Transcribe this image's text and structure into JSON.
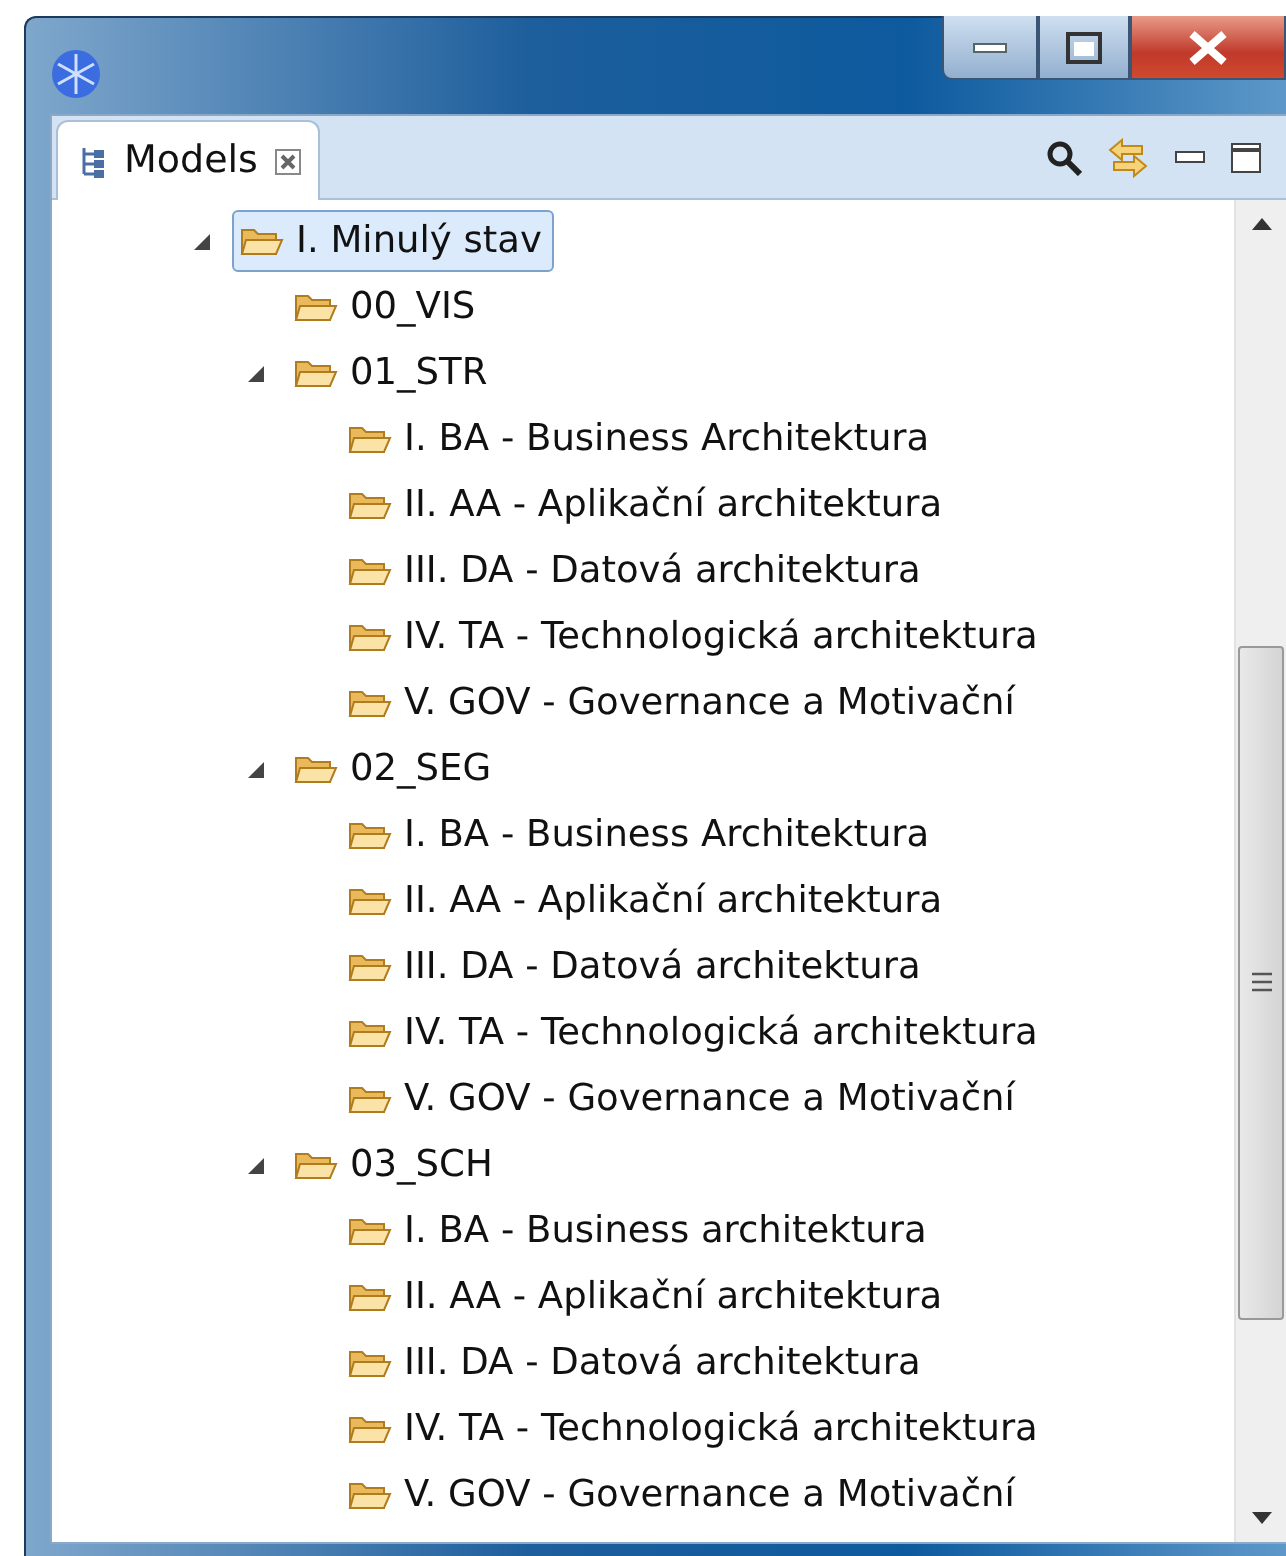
{
  "tabs": [
    {
      "label": "Models",
      "selected": true
    }
  ],
  "tree": [
    {
      "label": "I. Minulý stav",
      "selected": true,
      "expanded": true,
      "children": [
        {
          "label": "00_VIS",
          "selected": false
        },
        {
          "label": "01_STR",
          "selected": false,
          "expanded": true,
          "children": [
            {
              "label": "I. BA - Business Architektura",
              "selected": false
            },
            {
              "label": "II. AA - Aplikační architektura",
              "selected": false
            },
            {
              "label": "III. DA - Datová architektura",
              "selected": false
            },
            {
              "label": "IV. TA - Technologická architektura",
              "selected": false
            },
            {
              "label": "V. GOV - Governance a Motivační",
              "selected": false
            }
          ]
        },
        {
          "label": "02_SEG",
          "selected": false,
          "expanded": true,
          "children": [
            {
              "label": "I. BA - Business Architektura",
              "selected": false
            },
            {
              "label": "II. AA - Aplikační architektura",
              "selected": false
            },
            {
              "label": "III. DA - Datová architektura",
              "selected": false
            },
            {
              "label": "IV. TA - Technologická architektura",
              "selected": false
            },
            {
              "label": "V. GOV - Governance a Motivační",
              "selected": false
            }
          ]
        },
        {
          "label": "03_SCH",
          "selected": false,
          "expanded": true,
          "children": [
            {
              "label": "I. BA - Business architektura",
              "selected": false
            },
            {
              "label": "II. AA - Aplikační architektura",
              "selected": false
            },
            {
              "label": "III. DA - Datová architektura",
              "selected": false
            },
            {
              "label": "IV. TA - Technologická architektura",
              "selected": false
            },
            {
              "label": "V. GOV - Governance a Motivační",
              "selected": false
            }
          ]
        }
      ]
    }
  ]
}
